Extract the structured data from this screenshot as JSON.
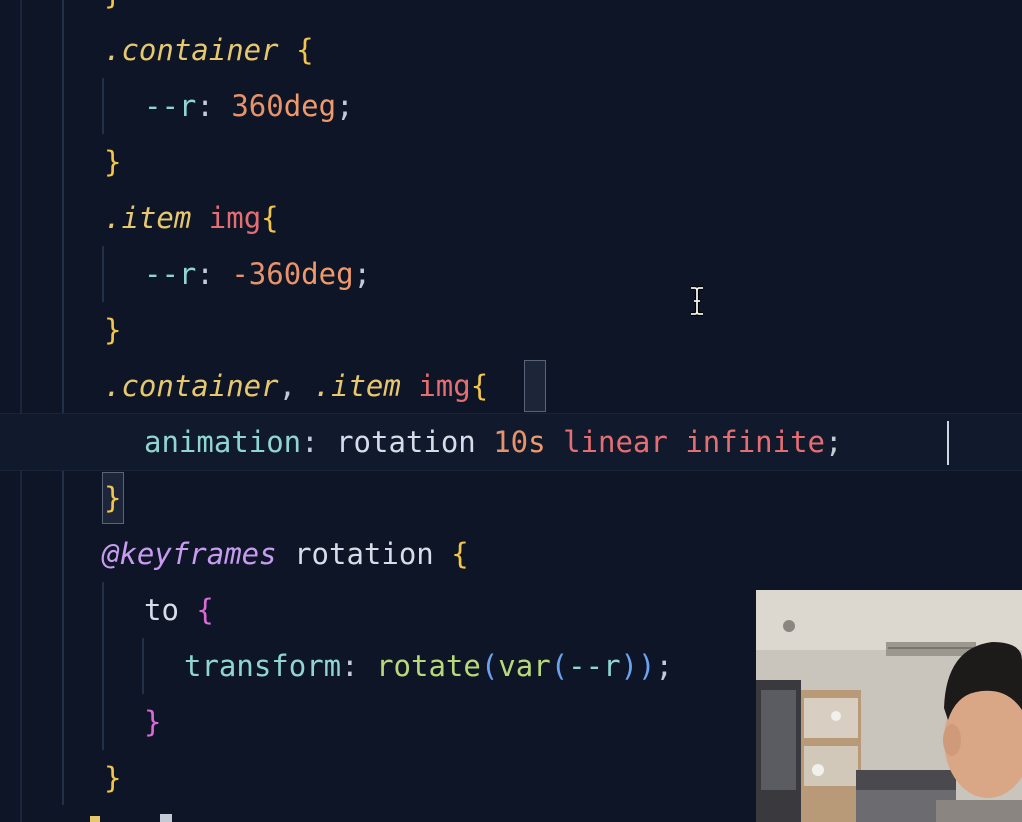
{
  "editor": {
    "lines": [
      {
        "id": "l0",
        "tokens": [
          {
            "t": "}",
            "c": "brace"
          }
        ]
      },
      {
        "id": "l1",
        "tokens": [
          {
            "t": ".container",
            "c": "sel"
          },
          {
            "t": " ",
            "c": "plain"
          },
          {
            "t": "{",
            "c": "brace"
          }
        ]
      },
      {
        "id": "l2",
        "tokens": [
          {
            "t": "--r",
            "c": "prop"
          },
          {
            "t": ": ",
            "c": "punc"
          },
          {
            "t": "360",
            "c": "num"
          },
          {
            "t": "deg",
            "c": "unit"
          },
          {
            "t": ";",
            "c": "punc"
          }
        ]
      },
      {
        "id": "l3",
        "tokens": [
          {
            "t": "}",
            "c": "brace"
          }
        ]
      },
      {
        "id": "l4",
        "tokens": [
          {
            "t": ".item",
            "c": "sel"
          },
          {
            "t": " ",
            "c": "plain"
          },
          {
            "t": "img",
            "c": "tag"
          },
          {
            "t": "{",
            "c": "brace"
          }
        ]
      },
      {
        "id": "l5",
        "tokens": [
          {
            "t": "--r",
            "c": "prop"
          },
          {
            "t": ": ",
            "c": "punc"
          },
          {
            "t": "-360",
            "c": "num"
          },
          {
            "t": "deg",
            "c": "unit"
          },
          {
            "t": ";",
            "c": "punc"
          }
        ]
      },
      {
        "id": "l6",
        "tokens": [
          {
            "t": "}",
            "c": "brace"
          }
        ]
      },
      {
        "id": "l7",
        "tokens": [
          {
            "t": ".container",
            "c": "sel"
          },
          {
            "t": ", ",
            "c": "punc"
          },
          {
            "t": ".item",
            "c": "sel"
          },
          {
            "t": " ",
            "c": "plain"
          },
          {
            "t": "img",
            "c": "tag"
          },
          {
            "t": "{",
            "c": "brace"
          }
        ]
      },
      {
        "id": "l8",
        "tokens": [
          {
            "t": "animation",
            "c": "prop"
          },
          {
            "t": ": ",
            "c": "punc"
          },
          {
            "t": "rotation",
            "c": "plain"
          },
          {
            "t": " ",
            "c": "plain"
          },
          {
            "t": "10",
            "c": "num"
          },
          {
            "t": "s",
            "c": "unit"
          },
          {
            "t": " ",
            "c": "plain"
          },
          {
            "t": "linear",
            "c": "kw"
          },
          {
            "t": " ",
            "c": "plain"
          },
          {
            "t": "infinite",
            "c": "kw"
          },
          {
            "t": ";",
            "c": "punc"
          }
        ]
      },
      {
        "id": "l9",
        "tokens": [
          {
            "t": "}",
            "c": "brace"
          }
        ]
      },
      {
        "id": "l10",
        "tokens": [
          {
            "t": "@keyframes",
            "c": "at"
          },
          {
            "t": " ",
            "c": "plain"
          },
          {
            "t": "rotation",
            "c": "plain"
          },
          {
            "t": " ",
            "c": "plain"
          },
          {
            "t": "{",
            "c": "brace"
          }
        ]
      },
      {
        "id": "l11",
        "tokens": [
          {
            "t": "to",
            "c": "plain"
          },
          {
            "t": " ",
            "c": "plain"
          },
          {
            "t": "{",
            "c": "brace2"
          }
        ]
      },
      {
        "id": "l12",
        "tokens": [
          {
            "t": "transform",
            "c": "prop"
          },
          {
            "t": ": ",
            "c": "punc"
          },
          {
            "t": "rotate",
            "c": "fn"
          },
          {
            "t": "(",
            "c": "paren"
          },
          {
            "t": "var",
            "c": "fn"
          },
          {
            "t": "(",
            "c": "paren"
          },
          {
            "t": "--r",
            "c": "prop"
          },
          {
            "t": ")",
            "c": "paren"
          },
          {
            "t": ")",
            "c": "paren"
          },
          {
            "t": ";",
            "c": "punc"
          }
        ]
      },
      {
        "id": "l13",
        "tokens": [
          {
            "t": "}",
            "c": "brace2"
          }
        ]
      },
      {
        "id": "l14",
        "tokens": [
          {
            "t": "}",
            "c": "brace"
          }
        ]
      }
    ]
  },
  "colors": {
    "background": "#0d1526",
    "selector": "#e8c86e",
    "brace": "#f3c54a",
    "property": "#8fd6d0",
    "number": "#e8926a",
    "keyword": "#e46e72",
    "at_rule": "#c79cf0",
    "function": "#b8d97a"
  },
  "icons": {
    "text_cursor": "ibeam-cursor-icon"
  }
}
